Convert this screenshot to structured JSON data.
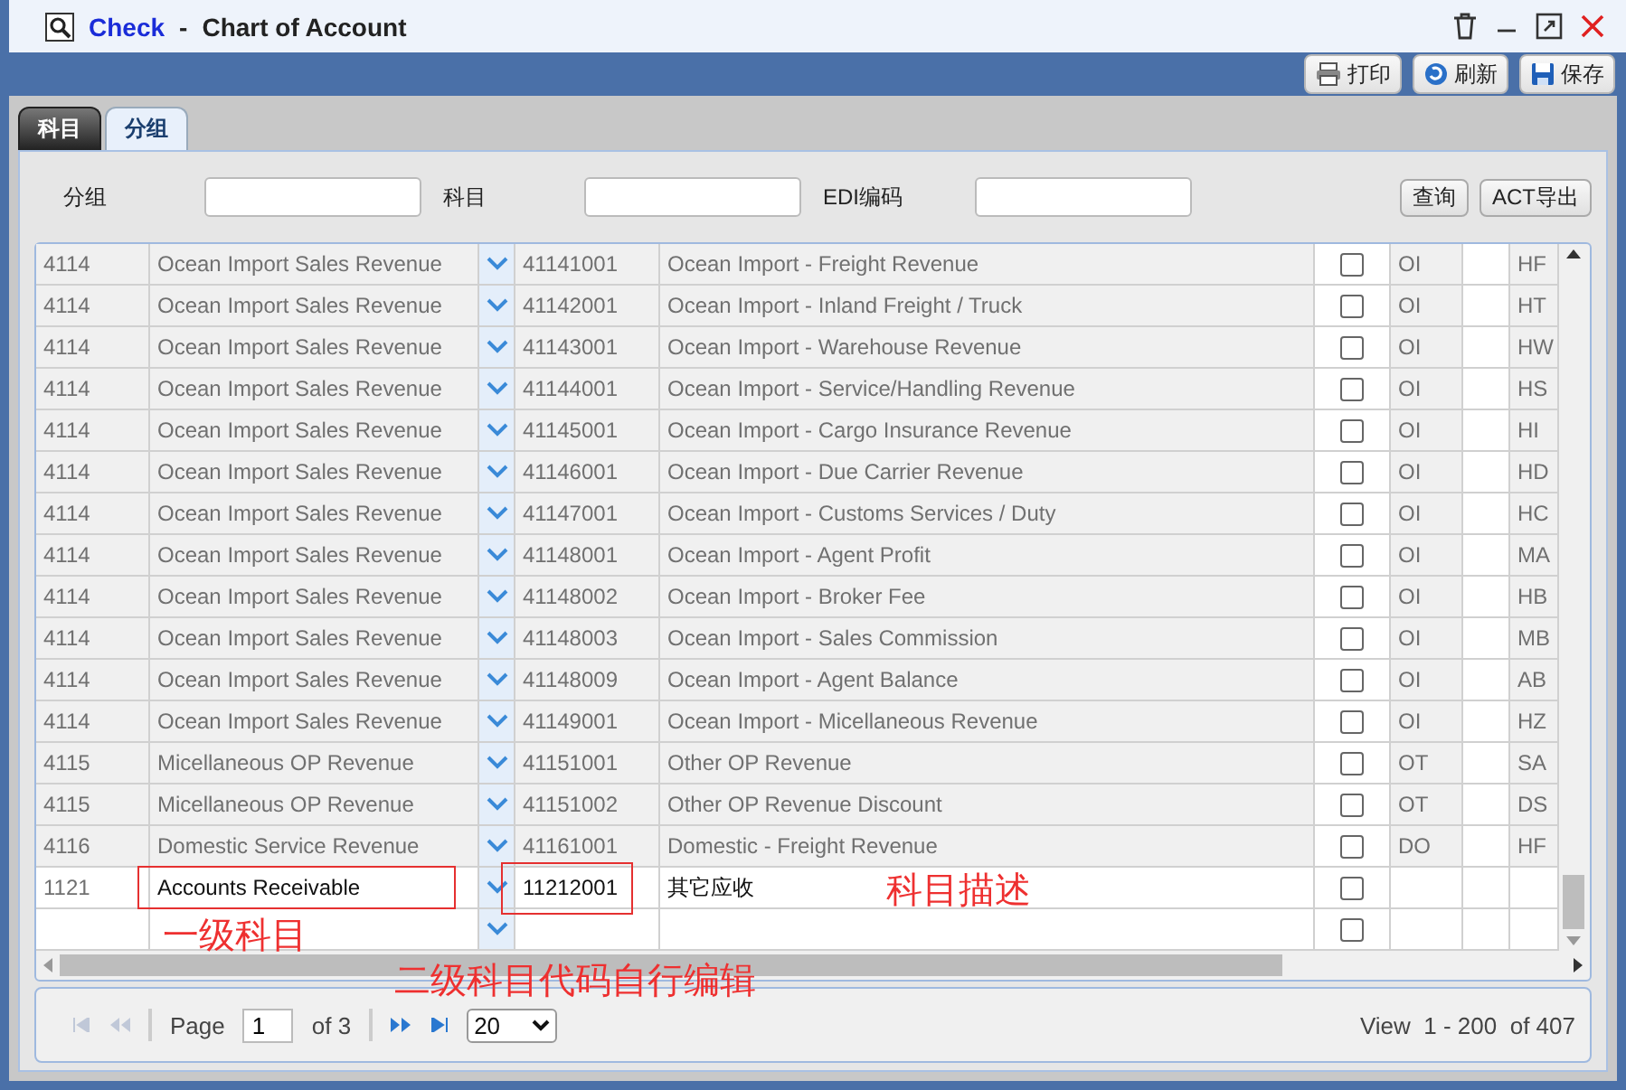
{
  "window": {
    "title_app": "Check",
    "title_sep": "-",
    "title": "Chart of Account"
  },
  "toolbar": {
    "buttons": [
      {
        "kind": "print",
        "label": "打印"
      },
      {
        "kind": "refresh",
        "label": "刷新"
      },
      {
        "kind": "save",
        "label": "保存"
      }
    ]
  },
  "tabs": [
    {
      "label": "科目",
      "selected": true
    },
    {
      "label": "分组",
      "selected": false
    }
  ],
  "filters": [
    {
      "label": "分组"
    },
    {
      "label": "科目"
    },
    {
      "label": "EDI编码"
    }
  ],
  "filter_buttons": [
    "查询",
    "ACT导出"
  ],
  "rows": [
    {
      "kind": "saved",
      "group_code": "4114",
      "group": "Ocean Import Sales Revenue",
      "code": "41141001",
      "description": "Ocean Import - Freight Revenue",
      "checked": false,
      "type": "OI",
      "edi": "HF"
    },
    {
      "kind": "saved",
      "group_code": "4114",
      "group": "Ocean Import Sales Revenue",
      "code": "41142001",
      "description": "Ocean Import - Inland Freight / Truck",
      "checked": false,
      "type": "OI",
      "edi": "HT"
    },
    {
      "kind": "saved",
      "group_code": "4114",
      "group": "Ocean Import Sales Revenue",
      "code": "41143001",
      "description": "Ocean Import - Warehouse Revenue",
      "checked": false,
      "type": "OI",
      "edi": "HW"
    },
    {
      "kind": "saved",
      "group_code": "4114",
      "group": "Ocean Import Sales Revenue",
      "code": "41144001",
      "description": "Ocean Import - Service/Handling Revenue",
      "checked": false,
      "type": "OI",
      "edi": "HS"
    },
    {
      "kind": "saved",
      "group_code": "4114",
      "group": "Ocean Import Sales Revenue",
      "code": "41145001",
      "description": "Ocean Import - Cargo Insurance Revenue",
      "checked": false,
      "type": "OI",
      "edi": "HI"
    },
    {
      "kind": "saved",
      "group_code": "4114",
      "group": "Ocean Import Sales Revenue",
      "code": "41146001",
      "description": "Ocean Import - Due Carrier Revenue",
      "checked": false,
      "type": "OI",
      "edi": "HD"
    },
    {
      "kind": "saved",
      "group_code": "4114",
      "group": "Ocean Import Sales Revenue",
      "code": "41147001",
      "description": "Ocean Import - Customs Services / Duty",
      "checked": false,
      "type": "OI",
      "edi": "HC"
    },
    {
      "kind": "saved",
      "group_code": "4114",
      "group": "Ocean Import Sales Revenue",
      "code": "41148001",
      "description": "Ocean Import - Agent Profit",
      "checked": false,
      "type": "OI",
      "edi": "MA"
    },
    {
      "kind": "saved",
      "group_code": "4114",
      "group": "Ocean Import Sales Revenue",
      "code": "41148002",
      "description": "Ocean Import - Broker Fee",
      "checked": false,
      "type": "OI",
      "edi": "HB"
    },
    {
      "kind": "saved",
      "group_code": "4114",
      "group": "Ocean Import Sales Revenue",
      "code": "41148003",
      "description": "Ocean Import - Sales Commission",
      "checked": false,
      "type": "OI",
      "edi": "MB"
    },
    {
      "kind": "saved",
      "group_code": "4114",
      "group": "Ocean Import Sales Revenue",
      "code": "41148009",
      "description": "Ocean Import - Agent Balance",
      "checked": false,
      "type": "OI",
      "edi": "AB"
    },
    {
      "kind": "saved",
      "group_code": "4114",
      "group": "Ocean Import Sales Revenue",
      "code": "41149001",
      "description": "Ocean Import - Micellaneous Revenue",
      "checked": false,
      "type": "OI",
      "edi": "HZ"
    },
    {
      "kind": "saved",
      "group_code": "4115",
      "group": "Micellaneous OP Revenue",
      "code": "41151001",
      "description": "Other OP Revenue",
      "checked": false,
      "type": "OT",
      "edi": "SA"
    },
    {
      "kind": "saved",
      "group_code": "4115",
      "group": "Micellaneous OP Revenue",
      "code": "41151002",
      "description": "Other OP Revenue Discount",
      "checked": false,
      "type": "OT",
      "edi": "DS"
    },
    {
      "kind": "saved",
      "group_code": "4116",
      "group": "Domestic Service Revenue",
      "code": "41161001",
      "description": "Domestic - Freight Revenue",
      "checked": false,
      "type": "DO",
      "edi": "HF"
    },
    {
      "kind": "editing",
      "group_code": "1121",
      "group": "Accounts Receivable",
      "code": "11212001",
      "description": "其它应收",
      "checked": false
    },
    {
      "kind": "new",
      "checked": false
    }
  ],
  "annotations": [
    {
      "kind": "group",
      "text": "一级科目"
    },
    {
      "kind": "code",
      "text": "二级科目代码自行编辑"
    },
    {
      "kind": "description",
      "text": "科目描述"
    }
  ],
  "pager": {
    "page_label": "Page",
    "page": "1",
    "of": "of 3",
    "page_size": "20",
    "view": "View  1 - 200  of 407"
  }
}
